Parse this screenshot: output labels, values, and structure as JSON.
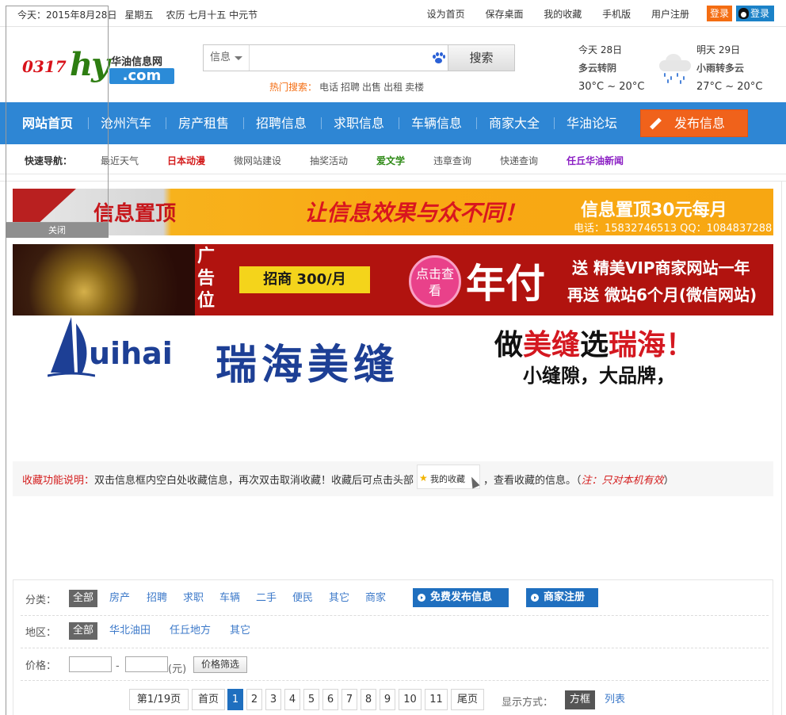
{
  "topbar": {
    "date_label": "今天：2015年8月28日",
    "weekday": "星期五",
    "lunar": "农历 七月十五 中元节",
    "links": [
      "设为首页",
      "保存桌面",
      "我的收藏",
      "手机版",
      "用户注册"
    ],
    "login_label": "登录",
    "qq_login_label": "登录"
  },
  "logo": {
    "number": "0317",
    "letters": "hy",
    "name": "华油信息网",
    "domain": ".com"
  },
  "search": {
    "category": "信息",
    "placeholder": "",
    "button_label": "搜索",
    "hot_label": "热门搜索：",
    "hot_keywords": [
      "电话",
      "招聘",
      "出售",
      "出租",
      "卖楼"
    ]
  },
  "weather": {
    "today": {
      "day": "今天 28日",
      "desc": "多云转阴",
      "temp": "30°C ~ 20°C"
    },
    "tomorrow": {
      "day": "明天 29日",
      "desc": "小雨转多云",
      "temp": "27°C ~ 20°C"
    }
  },
  "nav": {
    "items": [
      "网站首页",
      "沧州汽车",
      "房产租售",
      "招聘信息",
      "求职信息",
      "车辆信息",
      "商家大全",
      "华油论坛"
    ],
    "publish_label": "发布信息"
  },
  "quick_nav": {
    "label": "快速导航：",
    "items": [
      {
        "text": "最近天气",
        "color": "#555555"
      },
      {
        "text": "日本动漫",
        "color": "#d41e1e"
      },
      {
        "text": "微网站建设",
        "color": "#555555"
      },
      {
        "text": "抽奖活动",
        "color": "#555555"
      },
      {
        "text": "爱文学",
        "color": "#2e8a16"
      },
      {
        "text": "违章查询",
        "color": "#555555"
      },
      {
        "text": "快递查询",
        "color": "#555555"
      },
      {
        "text": "任丘华油新闻",
        "color": "#8b1fc4"
      }
    ]
  },
  "overlay": {
    "close_label": "关闭"
  },
  "banner1": {
    "title": "信息置顶",
    "slogan": "让信息效果与众不同！",
    "price": "信息置顶30元每月",
    "contact": "电话：15832746513  QQ：1084837288"
  },
  "banner2": {
    "ad_label": "广告位",
    "invest": "招商 300/月",
    "click": "点击查看",
    "year": "年付",
    "line1": "送 精美VIP商家网站一年",
    "line2": "再送 微站6个月(微信网站)"
  },
  "banner3": {
    "brand_en": "uihai",
    "brand_cn": "瑞海美缝",
    "slogan1_a": "做",
    "slogan1_b": "美缝",
    "slogan1_c": "选",
    "slogan1_d": "瑞海！",
    "slogan2": "小缝隙，大品牌，"
  },
  "fav": {
    "label": "收藏功能说明：",
    "text1": "双击信息框内空白处收藏信息，再次双击取消收藏！收藏后可点击头部",
    "button_label": "我的收藏",
    "text2": "，查看收藏的信息。（",
    "note": "注：只对本机有效",
    "text3": "）"
  },
  "filters": {
    "category": {
      "label": "分类：",
      "options": [
        "全部",
        "房产",
        "招聘",
        "求职",
        "车辆",
        "二手",
        "便民",
        "其它",
        "商家"
      ],
      "active": 0
    },
    "free_publish_label": "免费发布信息",
    "merchant_register_label": "商家注册",
    "area": {
      "label": "地区：",
      "options": [
        "全部",
        "华北油田",
        "任丘地方",
        "其它"
      ],
      "active": 0
    },
    "price": {
      "label": "价格：",
      "sep": "-",
      "unit": "(元)",
      "button_label": "价格筛选",
      "min_value": "",
      "max_value": ""
    }
  },
  "pagination": {
    "summary": "第1/19页",
    "first_label": "首页",
    "pages": [
      "1",
      "2",
      "3",
      "4",
      "5",
      "6",
      "7",
      "8",
      "9",
      "10",
      "11"
    ],
    "current": 1,
    "last_label": "尾页",
    "display_label": "显示方式：",
    "modes": [
      "方框",
      "列表"
    ],
    "active_mode": 0
  },
  "colors": {
    "nav_blue": "#2e86d4",
    "accent_orange": "#f0621b",
    "link_blue": "#3c79c9",
    "button_blue": "#1f6fbf"
  }
}
